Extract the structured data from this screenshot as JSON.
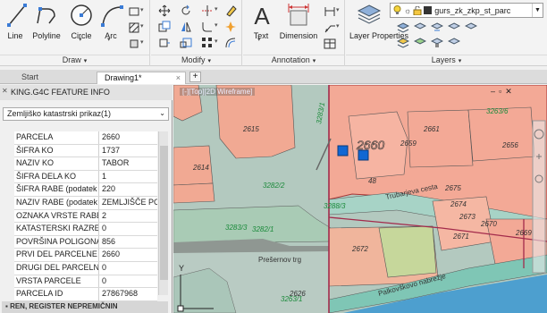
{
  "ribbon": {
    "draw": {
      "label": "Draw",
      "tools": [
        "Line",
        "Polyline",
        "Circle",
        "Arc"
      ]
    },
    "modify": {
      "label": "Modify"
    },
    "annotation": {
      "label": "Annotation",
      "tools": [
        "Text",
        "Dimension"
      ]
    },
    "layers": {
      "label": "Layers",
      "layer_properties": "Layer Properties",
      "current_layer": "gurs_zk_zkp_st_parc"
    }
  },
  "tabs": [
    {
      "label": "Start"
    },
    {
      "label": "Drawing1*"
    }
  ],
  "panel": {
    "title": "KING.G4C FEATURE INFO",
    "dataset": "Zemljiško katastrski prikaz(1)",
    "properties": [
      {
        "key": "PARCELA",
        "value": "2660"
      },
      {
        "key": "ŠIFRA KO",
        "value": "1737"
      },
      {
        "key": "NAZIV KO",
        "value": "TABOR"
      },
      {
        "key": "ŠIFRA DELA KO",
        "value": "1"
      },
      {
        "key": "ŠIFRA RABE (podatek v",
        "value": "220"
      },
      {
        "key": "NAZIV RABE (podatek v",
        "value": "ZEMLJIŠČE POD"
      },
      {
        "key": "OZNAKA VRSTE RABE (",
        "value": "2"
      },
      {
        "key": "KATASTERSKI RAZRED",
        "value": "0"
      },
      {
        "key": "POVRŠINA POLIGONA",
        "value": "856"
      },
      {
        "key": "PRVI DEL PARCELNE ŠT",
        "value": "2660"
      },
      {
        "key": "DRUGI DEL PARCELNE",
        "value": "0"
      },
      {
        "key": "VRSTA PARCELE",
        "value": "0"
      },
      {
        "key": "PARCELA ID",
        "value": "27867968"
      }
    ],
    "section": "REN, REGISTER NEPREMIČNIN"
  },
  "map": {
    "viewport_label": "[-][Top][2D Wireframe]",
    "parcels": [
      "2615",
      "2614",
      "2660",
      "2661",
      "2659",
      "2656",
      "2675",
      "2674",
      "2673",
      "2672",
      "2671",
      "2670",
      "2669",
      "2626",
      "3283/1",
      "3282/2",
      "3283/3",
      "3282/1",
      "3288/3",
      "3263/6",
      "3263/1",
      "48"
    ],
    "streets": [
      "Trubarjeva cesta",
      "Prešernov trg",
      "Palkovškovo nabrežje"
    ],
    "ucs_y": "Y"
  }
}
